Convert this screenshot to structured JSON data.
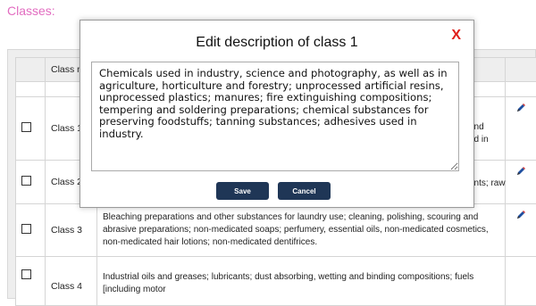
{
  "page": {
    "heading": "Classes:"
  },
  "table": {
    "header": {
      "name_col": "Class no"
    },
    "rows": [
      {
        "name": "Class 1",
        "desc_visible": "and\ned in"
      },
      {
        "name": "Class 2",
        "desc_visible": "ants; raw"
      },
      {
        "name": "Class 3",
        "desc": "Bleaching preparations and other substances for laundry use; cleaning, polishing, scouring and abrasive preparations; non-medicated soaps; perfumery, essential oils, non-medicated cosmetics, non-medicated hair lotions; non-medicated dentifrices."
      },
      {
        "name": "Class 4",
        "desc": "Industrial oils and greases; lubricants; dust absorbing, wetting and binding compositions; fuels [including motor"
      }
    ]
  },
  "modal": {
    "title": "Edit description of class 1",
    "close": "X",
    "description": "Chemicals used in industry, science and photography, as well as in agriculture, horticulture and forestry; unprocessed artificial resins, unprocessed plastics; manures; fire extinguishing compositions; tempering and soldering preparations; chemical substances for preserving foodstuffs; tanning substances; adhesives used in industry.",
    "save_label": "Save",
    "cancel_label": "Cancel"
  },
  "colors": {
    "heading": "#e26cc0",
    "button": "#1f3656",
    "close": "#e0201c",
    "pencil_body": "#1f4fa0",
    "pencil_tip": "#d23a3a"
  },
  "icons": {
    "edit": "pencil-icon",
    "checkbox": "checkbox-icon"
  }
}
